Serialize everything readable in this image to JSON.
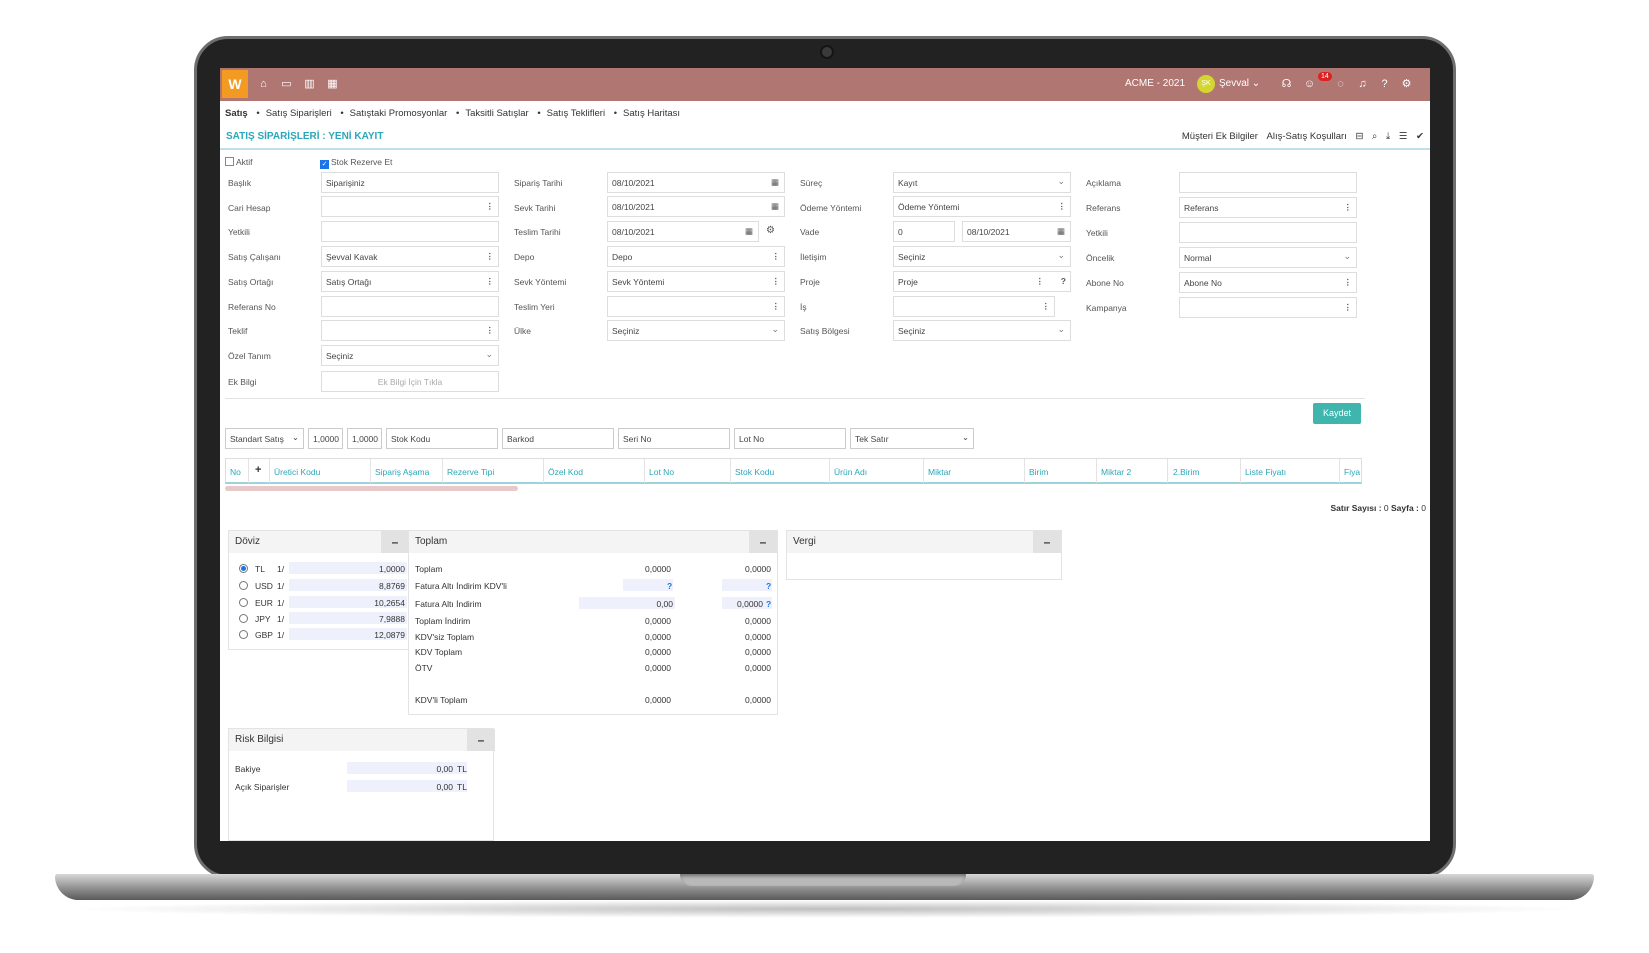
{
  "topbar": {
    "logo": "W",
    "company": "ACME - 2021",
    "avatar_initials": "ŞK",
    "user": "Şevval",
    "notification_count": "14"
  },
  "breadcrumbs": [
    "Satış",
    "Satış Siparişleri",
    "Satıştaki Promosyonlar",
    "Taksitli Satışlar",
    "Satış Teklifleri",
    "Satış Haritası"
  ],
  "page": {
    "title": "SATIŞ SİPARİŞLERİ : YENİ KAYIT",
    "link1": "Müşteri Ek Bilgiler",
    "link2": "Alış-Satış Koşulları"
  },
  "form": {
    "aktif": "Aktif",
    "stok_rezerve": "Stok Rezerve Et",
    "col1": {
      "baslik_label": "Başlık",
      "baslik_value": "Siparişiniz",
      "cari_label": "Cari Hesap",
      "yetkili_label": "Yetkili",
      "satis_calisani_label": "Satış Çalışanı",
      "satis_calisani_value": "Şevval Kavak",
      "satis_ortagi_label": "Satış Ortağı",
      "satis_ortagi_value": "Satış Ortağı",
      "referans_no_label": "Referans No",
      "teklif_label": "Teklif",
      "ozel_tanim_label": "Özel Tanım",
      "ozel_tanim_value": "Seçiniz",
      "ek_bilgi_label": "Ek Bilgi",
      "ek_bilgi_value": "Ek Bilgi İçin Tıkla"
    },
    "col2": {
      "siparis_tarihi_label": "Sipariş Tarihi",
      "siparis_tarihi_value": "08/10/2021",
      "sevk_tarihi_label": "Sevk Tarihi",
      "sevk_tarihi_value": "08/10/2021",
      "teslim_tarihi_label": "Teslim Tarihi",
      "teslim_tarihi_value": "08/10/2021",
      "depo_label": "Depo",
      "depo_value": "Depo",
      "sevk_yontemi_label": "Sevk Yöntemi",
      "sevk_yontemi_value": "Sevk Yöntemi",
      "teslim_yeri_label": "Teslim Yeri",
      "ulke_label": "Ülke",
      "ulke_value": "Seçiniz"
    },
    "col3": {
      "surec_label": "Süreç",
      "surec_value": "Kayıt",
      "odeme_label": "Ödeme Yöntemi",
      "odeme_value": "Ödeme Yöntemi",
      "vade_label": "Vade",
      "vade_value": "0",
      "vade_date": "08/10/2021",
      "iletisim_label": "İletişim",
      "iletisim_value": "Seçiniz",
      "proje_label": "Proje",
      "proje_value": "Proje",
      "is_label": "İş",
      "satis_bolgesi_label": "Satış Bölgesi",
      "satis_bolgesi_value": "Seçiniz"
    },
    "col4": {
      "aciklama_label": "Açıklama",
      "referans_label": "Referans",
      "referans_value": "Referans",
      "yetkili_label": "Yetkili",
      "oncelik_label": "Öncelik",
      "oncelik_value": "Normal",
      "abone_label": "Abone No",
      "abone_value": "Abone No",
      "kampanya_label": "Kampanya"
    },
    "save": "Kaydet"
  },
  "grid": {
    "toolbar": {
      "type": "Standart Satış",
      "q1": "1,0000",
      "q2": "1,0000",
      "stok_kodu": "Stok Kodu",
      "barkod": "Barkod",
      "seri_no": "Seri No",
      "lot_no": "Lot No",
      "mode": "Tek Satır"
    },
    "columns": [
      "No",
      "+",
      "Üretici Kodu",
      "Sipariş Aşama",
      "Rezerve Tipi",
      "Özel Kod",
      "Lot No",
      "Stok Kodu",
      "Ürün Adı",
      "Miktar",
      "Birim",
      "Miktar 2",
      "2.Birim",
      "Liste Fiyatı",
      "Fiya"
    ],
    "row_count_label": "Satır Sayısı :",
    "row_count": "0",
    "page_label": "Sayfa :",
    "page": "0"
  },
  "doviz": {
    "title": "Döviz",
    "rows": [
      {
        "code": "TL",
        "mult": "1/",
        "value": "1,0000"
      },
      {
        "code": "USD",
        "mult": "1/",
        "value": "8,8769"
      },
      {
        "code": "EUR",
        "mult": "1/",
        "value": "10,2654"
      },
      {
        "code": "JPY",
        "mult": "1/",
        "value": "7,9888"
      },
      {
        "code": "GBP",
        "mult": "1/",
        "value": "12,0879"
      }
    ]
  },
  "toplam": {
    "title": "Toplam",
    "rows": [
      {
        "label": "Toplam",
        "v1": "0,0000",
        "v2": "0,0000"
      },
      {
        "label": "Fatura Altı İndirim KDV'li",
        "v1": "?",
        "v2": "?"
      },
      {
        "label": "Fatura Altı İndirim",
        "v1": "0,00",
        "v2": "0,0000"
      },
      {
        "label": "Toplam İndirim",
        "v1": "0,0000",
        "v2": "0,0000"
      },
      {
        "label": "KDV'siz Toplam",
        "v1": "0,0000",
        "v2": "0,0000"
      },
      {
        "label": "KDV Toplam",
        "v1": "0,0000",
        "v2": "0,0000"
      },
      {
        "label": "ÖTV",
        "v1": "0,0000",
        "v2": "0,0000"
      },
      {
        "label": "KDV'li Toplam",
        "v1": "0,0000",
        "v2": "0,0000"
      }
    ],
    "q_mark": "?"
  },
  "vergi": {
    "title": "Vergi"
  },
  "risk": {
    "title": "Risk Bilgisi",
    "rows": [
      {
        "label": "Bakiye",
        "value": "0,00",
        "cur": "TL"
      },
      {
        "label": "Açık Siparişler",
        "value": "0,00",
        "cur": "TL"
      }
    ]
  },
  "minimize": "–"
}
